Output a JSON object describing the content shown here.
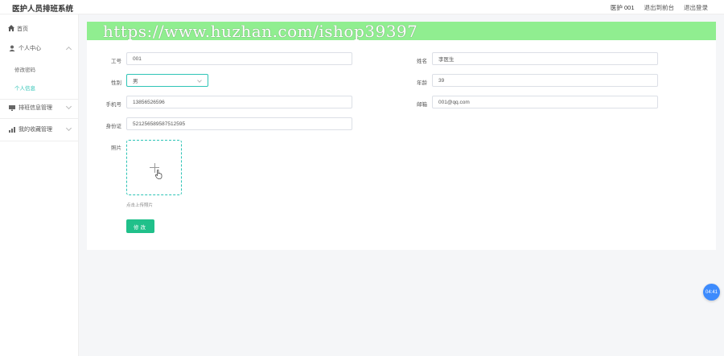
{
  "app": {
    "title": "医护人员排班系统"
  },
  "topbar": {
    "user": "医护 001",
    "back_label": "退出到前台",
    "logout_label": "退出登录"
  },
  "sidebar": {
    "home_label": "首页",
    "groups": [
      {
        "label": "个人中心",
        "icon": "user-icon",
        "subitems": [
          "修改密码",
          "个人信息"
        ]
      },
      {
        "label": "排班信息管理",
        "icon": "monitor-icon"
      },
      {
        "label": "我的收藏管理",
        "icon": "chart-icon"
      }
    ],
    "active_subitem": "个人信息"
  },
  "watermark": {
    "text": "https://www.huzhan.com/ishop39397"
  },
  "form": {
    "id_label": "工号",
    "id_value": "001",
    "name_label": "姓名",
    "name_value": "李医生",
    "gender_label": "性别",
    "gender_value": "男",
    "age_label": "年龄",
    "age_value": "39",
    "phone_label": "手机号",
    "phone_value": "13856526596",
    "email_label": "邮箱",
    "email_value": "001@qq.com",
    "idcard_label": "身份证",
    "idcard_value": "521256589587512595",
    "photo_label": "照片",
    "upload_hint": "点击上传照片",
    "submit_label": "修改"
  },
  "timer": {
    "value": "04:41"
  },
  "colors": {
    "accent": "#2ec4b6",
    "button": "#20c08a",
    "watermark_bg": "#90ee90",
    "timer": "#3d8bfd"
  }
}
